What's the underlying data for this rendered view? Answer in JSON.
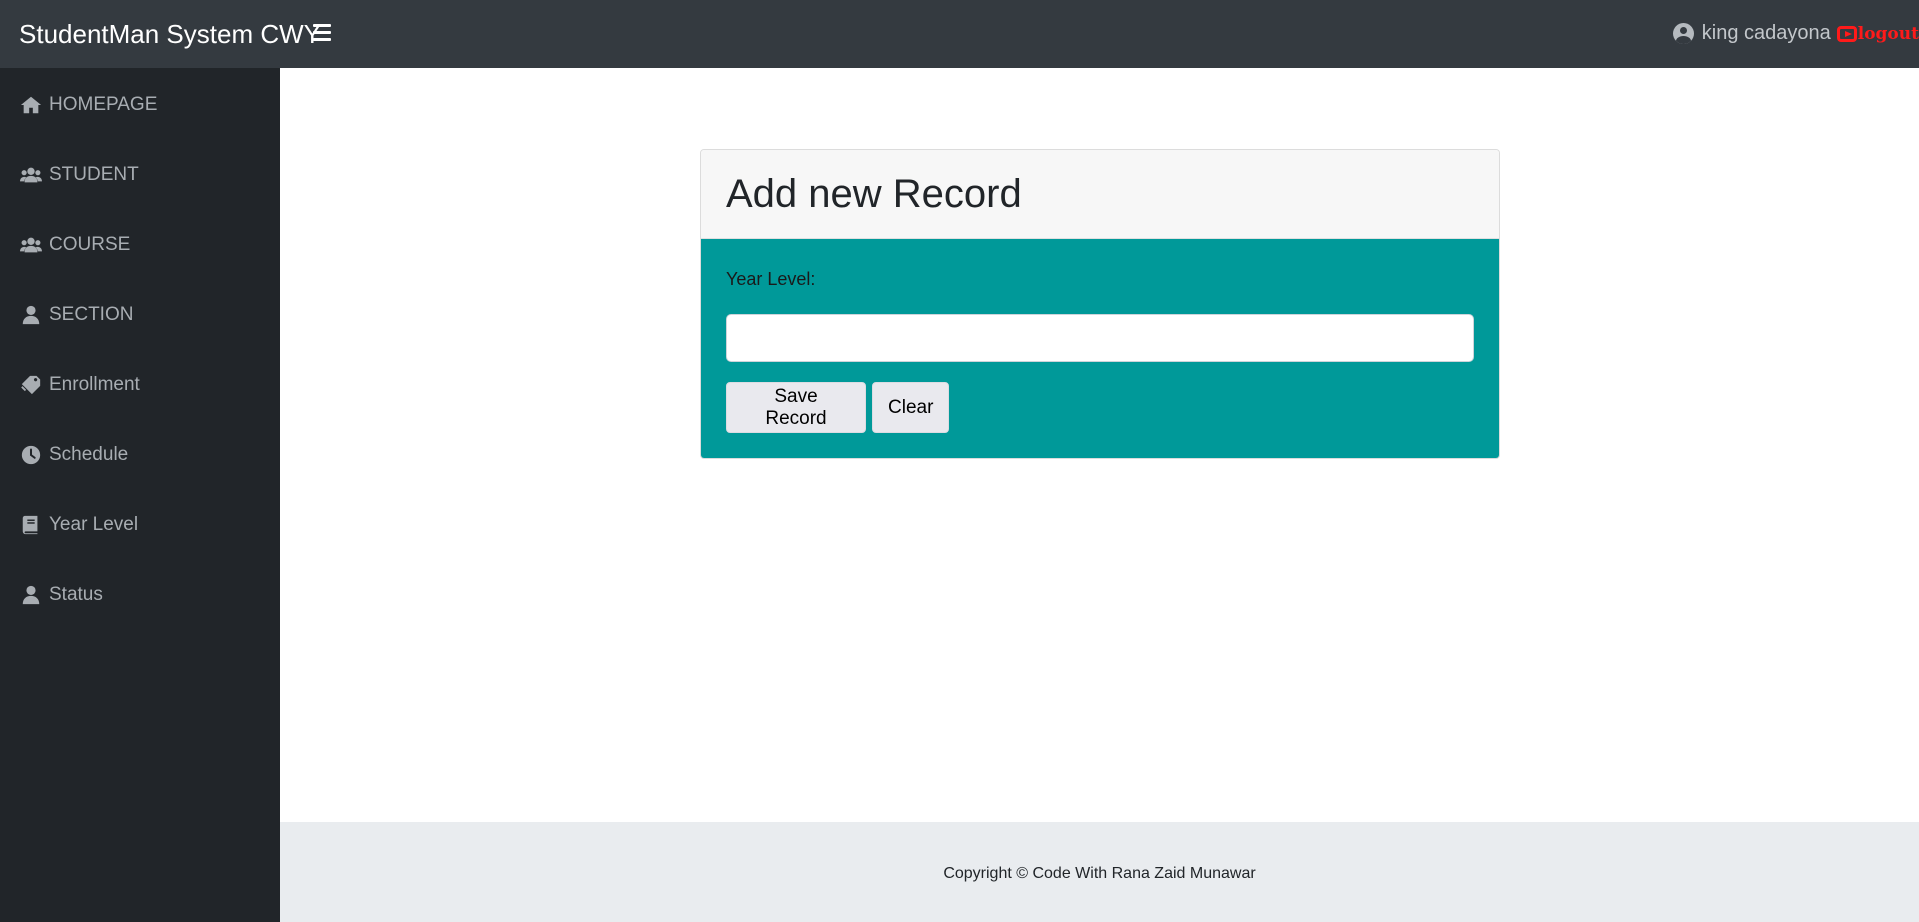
{
  "app": {
    "brand": "StudentMan System CWY",
    "user_name": "king cadayona",
    "logout_label": "logout"
  },
  "sidebar": {
    "items": [
      {
        "label": "HOMEPAGE",
        "icon": "home-icon"
      },
      {
        "label": "STUDENT",
        "icon": "users-icon"
      },
      {
        "label": "COURSE",
        "icon": "users-icon"
      },
      {
        "label": "SECTION",
        "icon": "user-icon"
      },
      {
        "label": "Enrollment",
        "icon": "tag-icon"
      },
      {
        "label": "Schedule",
        "icon": "clock-icon"
      },
      {
        "label": "Year Level",
        "icon": "book-icon"
      },
      {
        "label": "Status",
        "icon": "user-icon"
      }
    ]
  },
  "form": {
    "title": "Add new Record",
    "field_label": "Year Level:",
    "field_value": "",
    "field_placeholder": "",
    "save_label": "Save Record",
    "clear_label": "Clear"
  },
  "footer": {
    "copyright": "Copyright © Code With Rana Zaid Munawar"
  },
  "colors": {
    "topbar": "#343a40",
    "sidebar": "#212529",
    "card_body": "#009999",
    "logout": "#ff1a1a",
    "footer": "#e9ecef"
  }
}
